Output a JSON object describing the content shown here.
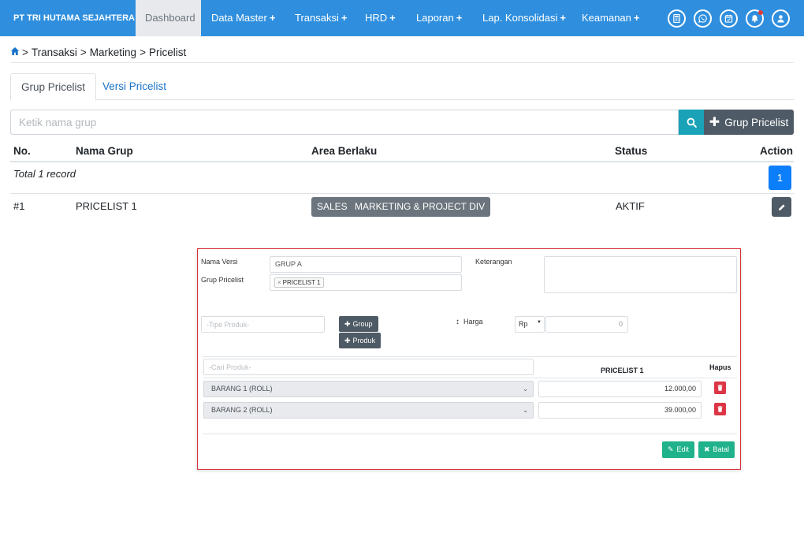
{
  "navbar": {
    "brand": "PT TRI HUTAMA SEJAHTERA",
    "items": [
      {
        "label": "Dashboard",
        "plus": ""
      },
      {
        "label": "Data Master",
        "plus": "+"
      },
      {
        "label": "Transaksi",
        "plus": "+"
      },
      {
        "label": "HRD",
        "plus": "+"
      },
      {
        "label": "Laporan",
        "plus": "+"
      },
      {
        "label": "Lap. Konsolidasi",
        "plus": "+"
      },
      {
        "label": "Keamanan",
        "plus": "+"
      }
    ],
    "active_item": "Dashboard",
    "icons": [
      "calculator-icon",
      "whatsapp-icon",
      "calendar-icon",
      "bell-icon",
      "user-icon"
    ],
    "accent_color": "#2f8fde"
  },
  "breadcrumb": {
    "items": [
      "Transaksi",
      "Marketing",
      "Pricelist"
    ],
    "separator": ">"
  },
  "tabs": [
    "Grup Pricelist",
    "Versi Pricelist"
  ],
  "search": {
    "placeholder": "Ketik nama grup",
    "add_button_label": "Grup Pricelist"
  },
  "table": {
    "headers": [
      "No.",
      "Nama Grup",
      "Area Berlaku",
      "Status",
      "Action"
    ],
    "total_text": "Total 1 record",
    "current_page": "1",
    "rows": [
      {
        "no": "#1",
        "name": "PRICELIST 1",
        "areas": [
          "SALES",
          "MARKETING & PROJECT DIV"
        ],
        "status": "AKTIF"
      }
    ]
  },
  "form": {
    "nama_versi_label": "Nama Versi",
    "nama_versi_value": "GRUP A",
    "grup_pricelist_label": "Grup Pricelist",
    "grup_pricelist_tag": "PRICELIST 1",
    "tag_remove": "×",
    "keterangan_label": "Keterangan",
    "keterangan_value": "",
    "tipe_produk_placeholder": "-Tipe Produk-",
    "group_button_label": "Group",
    "produk_button_label": "Produk",
    "harga_label": "Harga",
    "currency": "Rp",
    "price_value": "0",
    "cari_produk_placeholder": "-Cari Produk-",
    "price_column_header": "PRICELIST 1",
    "hapus_header": "Hapus",
    "products": [
      {
        "name": "BARANG 1 (ROLL)",
        "price": "12.000,00"
      },
      {
        "name": "BARANG 2 (ROLL)",
        "price": "39.000,00"
      }
    ],
    "edit_button_label": "Edit",
    "cancel_button_label": "Batal"
  }
}
